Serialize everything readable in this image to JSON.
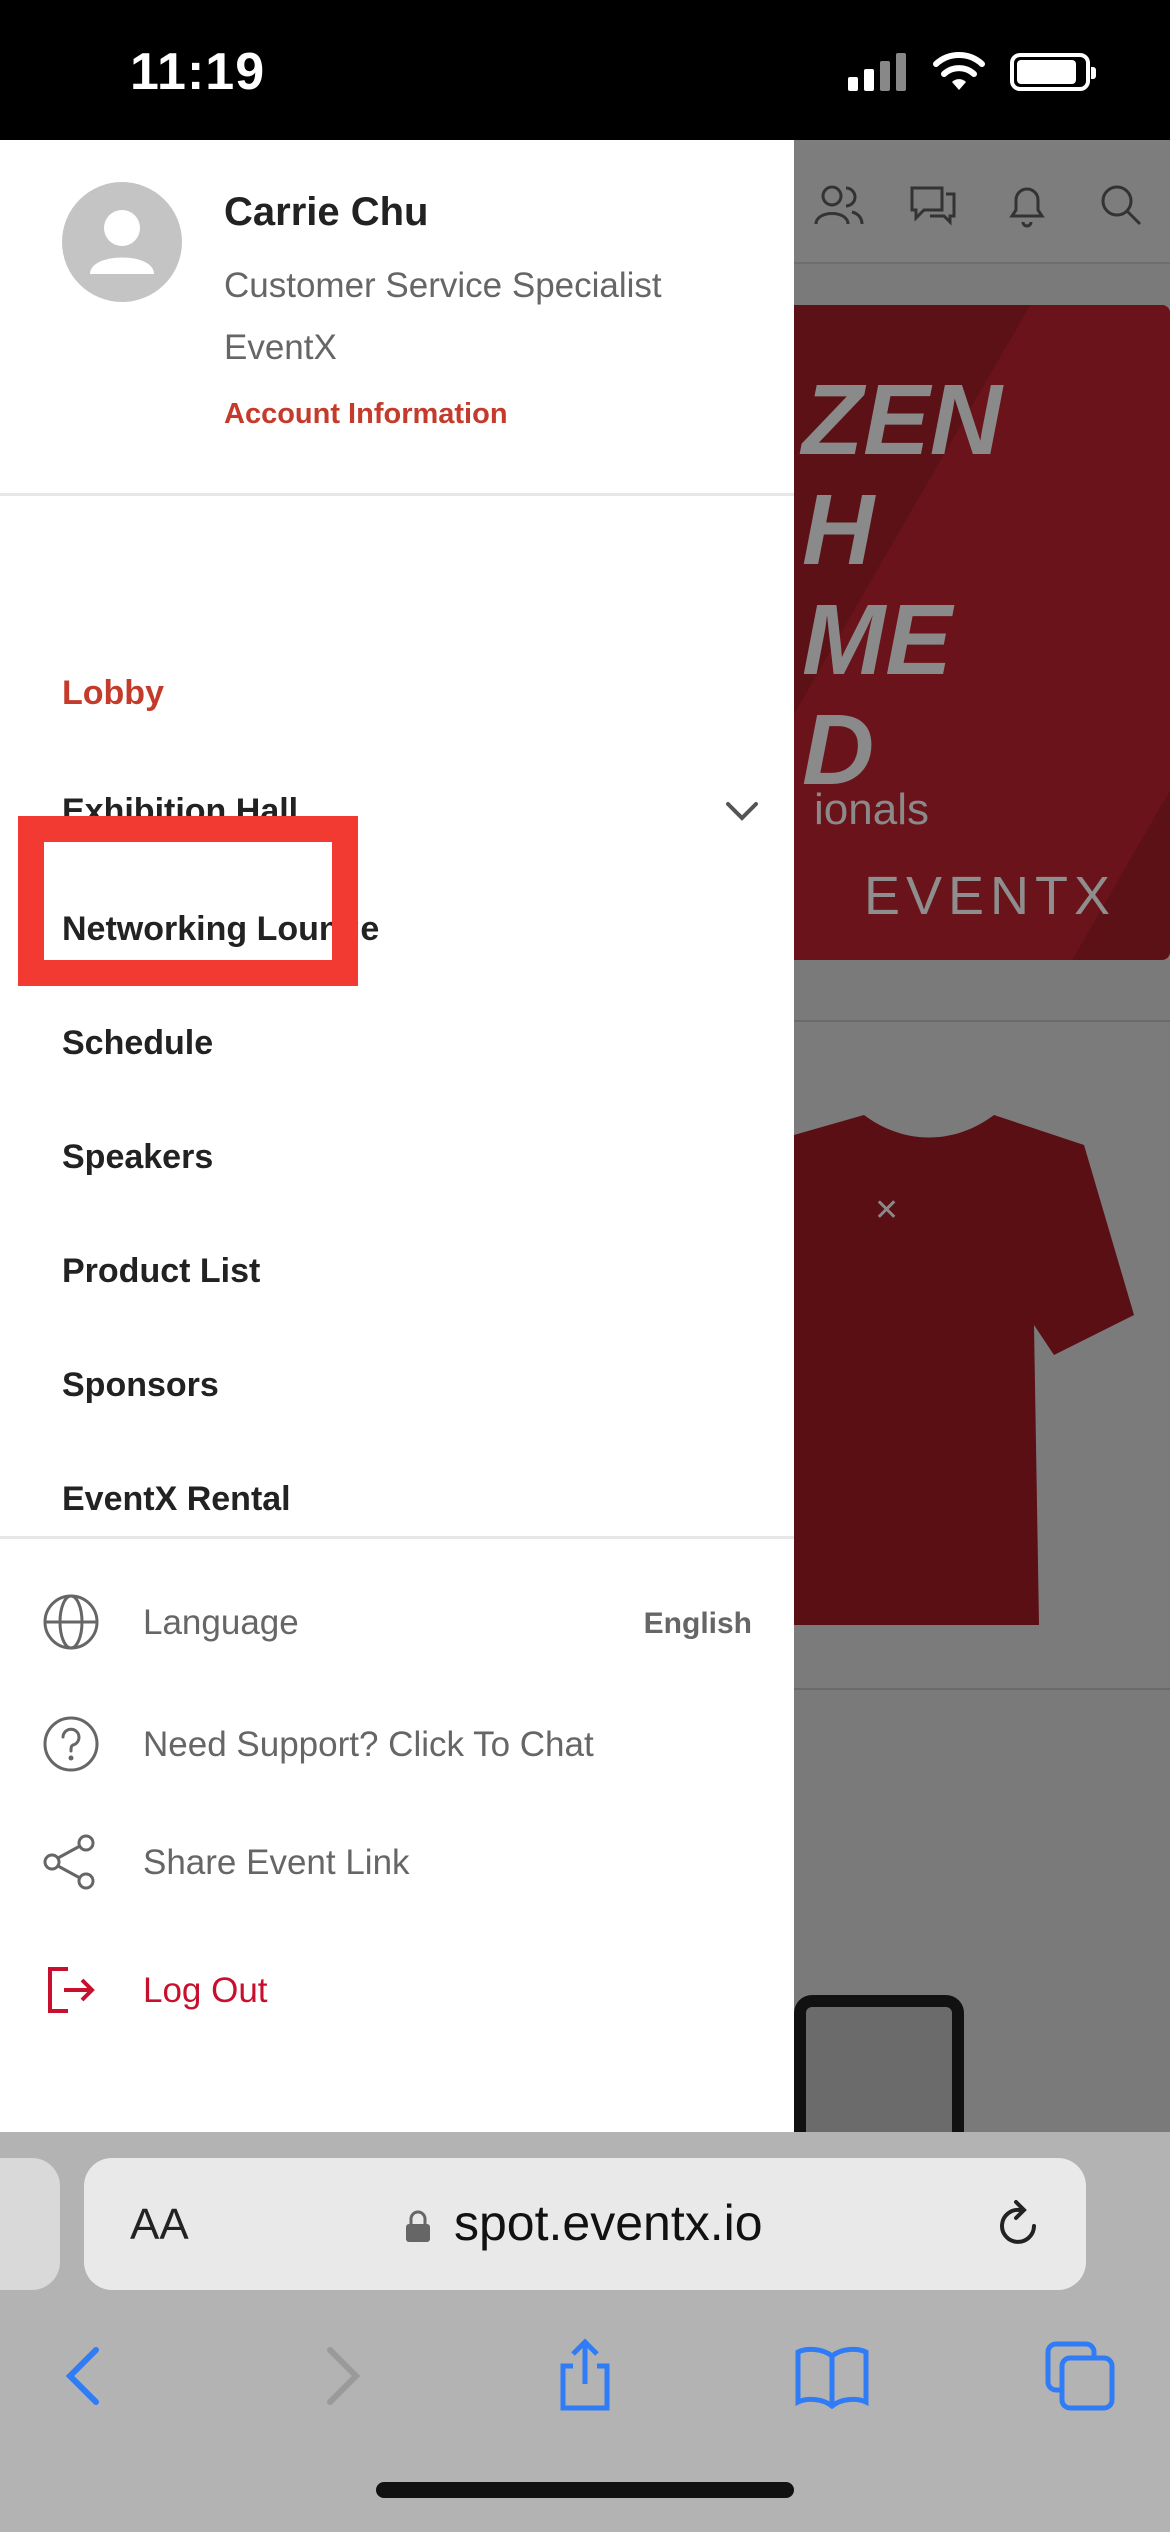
{
  "status_bar": {
    "time": "11:19"
  },
  "profile": {
    "name": "Carrie Chu",
    "title": "Customer Service Specialist",
    "company": "EventX",
    "account_link": "Account Information"
  },
  "nav": {
    "items": [
      {
        "label": "Lobby",
        "active": true
      },
      {
        "label": "Exhibition Hall",
        "expandable": true
      },
      {
        "label": "Networking Lounge"
      },
      {
        "label": "Schedule",
        "highlighted": true
      },
      {
        "label": "Speakers"
      },
      {
        "label": "Product List"
      },
      {
        "label": "Sponsors"
      },
      {
        "label": "EventX Rental"
      }
    ]
  },
  "footer": {
    "language": {
      "label": "Language",
      "value": "English",
      "icon": "globe-icon"
    },
    "support": {
      "label": "Need Support? Click To Chat",
      "icon": "question-circle-icon"
    },
    "share": {
      "label": "Share Event Link",
      "icon": "share-icon"
    },
    "logout": {
      "label": "Log Out",
      "icon": "logout-icon"
    }
  },
  "background_page": {
    "banner_text": [
      "ZEN",
      "H",
      "ME",
      "D"
    ],
    "banner_small": "ionals",
    "brand": "EVENTX"
  },
  "browser": {
    "text_size_label": "AA",
    "url": "spot.eventx.io"
  },
  "colors": {
    "accent": "#c53b2b",
    "logout": "#c8102e",
    "highlight_box": "#f23a33",
    "ios_blue": "#2f7cf6"
  }
}
